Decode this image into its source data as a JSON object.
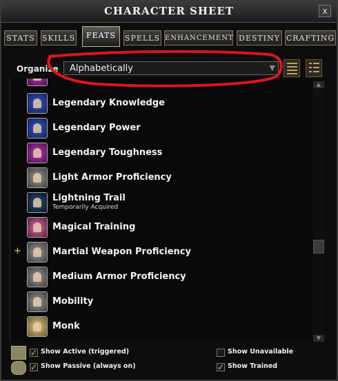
{
  "window": {
    "title": "CHARACTER SHEET",
    "close_label": "x"
  },
  "tabs": [
    {
      "label": "STATS",
      "active": false
    },
    {
      "label": "SKILLS",
      "active": false
    },
    {
      "label": "FEATS",
      "active": true
    },
    {
      "label": "SPELLS",
      "active": false
    },
    {
      "label": "ENHANCEMENT",
      "active": false
    },
    {
      "label": "DESTINY",
      "active": false
    },
    {
      "label": "CRAFTING",
      "active": false
    }
  ],
  "organize": {
    "label": "Organize",
    "selected": "Alphabetically"
  },
  "feats": [
    {
      "name": "Legendary Knowledge",
      "sub": "",
      "icon": "fist-blue-icon",
      "expandable": false
    },
    {
      "name": "Legendary Power",
      "sub": "",
      "icon": "fist-blue-icon",
      "expandable": false
    },
    {
      "name": "Legendary Toughness",
      "sub": "",
      "icon": "fist-magenta-icon",
      "expandable": false
    },
    {
      "name": "Light Armor Proficiency",
      "sub": "",
      "icon": "armor-figure-icon",
      "expandable": false
    },
    {
      "name": "Lightning Trail",
      "sub": "Temporarily Acquired",
      "icon": "lightning-icon",
      "expandable": false
    },
    {
      "name": "Magical Training",
      "sub": "",
      "icon": "magic-head-icon",
      "expandable": false
    },
    {
      "name": "Martial Weapon Proficiency",
      "sub": "",
      "icon": "crossed-swords-icon",
      "expandable": true
    },
    {
      "name": "Medium Armor Proficiency",
      "sub": "",
      "icon": "armor-figure-icon",
      "expandable": false
    },
    {
      "name": "Mobility",
      "sub": "",
      "icon": "running-figure-icon",
      "expandable": false
    },
    {
      "name": "Monk",
      "sub": "",
      "icon": "monk-symbol-icon",
      "expandable": false
    }
  ],
  "expand_label": "+",
  "filters": {
    "show_active": {
      "label": "Show Active (triggered)",
      "checked": true
    },
    "show_passive": {
      "label": "Show Passive (always on)",
      "checked": true
    },
    "show_unavailable": {
      "label": "Show Unavailable",
      "checked": false
    },
    "show_trained": {
      "label": "Show Trained",
      "checked": true
    }
  },
  "check_mark": "✓",
  "colors": {
    "annotation": "#e0141e",
    "accent_gold": "#c9a24a"
  }
}
